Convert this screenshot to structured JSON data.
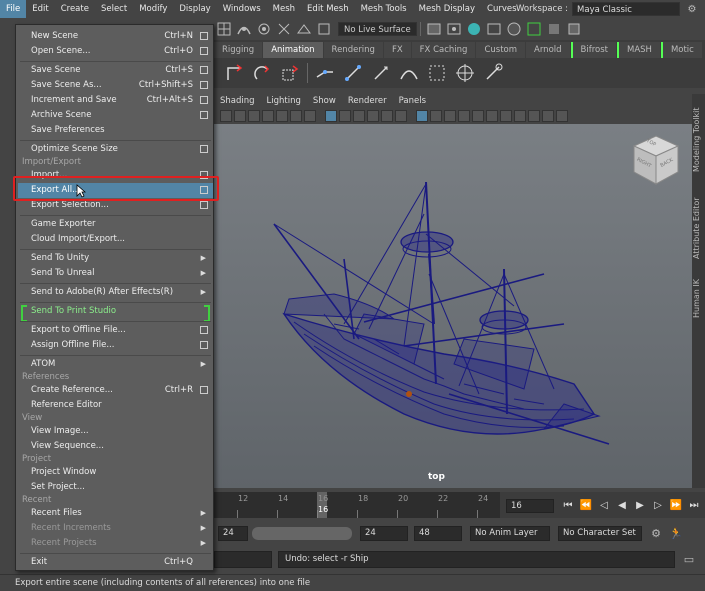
{
  "menubar": {
    "items": [
      "File",
      "Edit",
      "Create",
      "Select",
      "Modify",
      "Display",
      "Windows",
      "Mesh",
      "Edit Mesh",
      "Mesh Tools",
      "Mesh Display",
      "Curves"
    ],
    "active": "File"
  },
  "workspace": {
    "label": "Workspace :",
    "value": "Maya Classic"
  },
  "toolbar": {
    "live_surface": "No Live Surface"
  },
  "shelf_tabs": [
    "Rigging",
    "Animation",
    "Rendering",
    "FX",
    "FX Caching",
    "Custom",
    "Arnold",
    "Bifrost",
    "MASH",
    "Motic"
  ],
  "shelf_active": "Animation",
  "panel_menu": [
    "Shading",
    "Lighting",
    "Show",
    "Renderer",
    "Panels"
  ],
  "viewport": {
    "camera_label": "top"
  },
  "side_tabs": [
    "Modeling Toolkit",
    "Attribute Editor",
    "Human IK"
  ],
  "viewcube": {
    "face1": "RIGHT",
    "face2": "BACK",
    "face3": "TOP"
  },
  "file_menu": {
    "items": [
      {
        "label": "New Scene",
        "shortcut": "Ctrl+N",
        "option": true
      },
      {
        "label": "Open Scene...",
        "shortcut": "Ctrl+O",
        "option": true
      },
      {
        "label": "Save Scene",
        "shortcut": "Ctrl+S",
        "option": true
      },
      {
        "label": "Save Scene As...",
        "shortcut": "Ctrl+Shift+S",
        "option": true
      },
      {
        "label": "Increment and Save",
        "shortcut": "Ctrl+Alt+S",
        "option": true
      },
      {
        "label": "Archive Scene",
        "shortcut": "",
        "option": true
      },
      {
        "label": "Save Preferences",
        "shortcut": "",
        "option": false
      },
      {
        "label": "Optimize Scene Size",
        "shortcut": "",
        "option": true
      },
      {
        "label": "Import...",
        "shortcut": "",
        "option": true
      },
      {
        "label": "Export All...",
        "shortcut": "",
        "option": true
      },
      {
        "label": "Export Selection...",
        "shortcut": "",
        "option": true
      },
      {
        "label": "Game Exporter",
        "shortcut": "",
        "option": false
      },
      {
        "label": "Cloud Import/Export...",
        "shortcut": "",
        "option": false
      },
      {
        "label": "Send To Unity",
        "shortcut": "",
        "submenu": true
      },
      {
        "label": "Send To Unreal",
        "shortcut": "",
        "submenu": true
      },
      {
        "label": "Send to Adobe(R) After Effects(R)",
        "shortcut": "",
        "submenu": true
      },
      {
        "label": "Send To Print Studio",
        "shortcut": ""
      },
      {
        "label": "Export to Offline File...",
        "shortcut": "",
        "option": true
      },
      {
        "label": "Assign Offline File...",
        "shortcut": "",
        "option": true
      },
      {
        "label": "ATOM",
        "shortcut": "",
        "submenu": true
      },
      {
        "label": "Create Reference...",
        "shortcut": "Ctrl+R",
        "option": true
      },
      {
        "label": "Reference Editor",
        "shortcut": ""
      },
      {
        "label": "View Image...",
        "shortcut": ""
      },
      {
        "label": "View Sequence...",
        "shortcut": ""
      },
      {
        "label": "Project Window",
        "shortcut": ""
      },
      {
        "label": "Set Project...",
        "shortcut": ""
      },
      {
        "label": "Recent Files",
        "shortcut": "",
        "submenu": true
      },
      {
        "label": "Recent Increments",
        "shortcut": "",
        "submenu": true,
        "disabled": true
      },
      {
        "label": "Recent Projects",
        "shortcut": "",
        "submenu": true,
        "disabled": true
      },
      {
        "label": "Exit",
        "shortcut": "Ctrl+Q"
      }
    ],
    "sections": [
      "Import/Export",
      "References",
      "View",
      "Project",
      "Recent"
    ],
    "highlighted": "Export All..."
  },
  "timeline": {
    "ticks": [
      "12",
      "14",
      "16",
      "18",
      "20",
      "22",
      "24"
    ],
    "current_frame": "16",
    "frame_field": "16"
  },
  "range": {
    "field1": "24",
    "field2": "24",
    "field3": "48",
    "anim_layer": "No Anim Layer",
    "character_set": "No Character Set"
  },
  "command_line": {
    "output": "Undo: select -r Ship"
  },
  "help_line": "Export entire scene (including contents of all references) into one file",
  "colors": {
    "highlight": "#5285a6",
    "wireframe": "#1a1a80",
    "annotation": "#e02020",
    "green_bracket": "#40d040"
  }
}
